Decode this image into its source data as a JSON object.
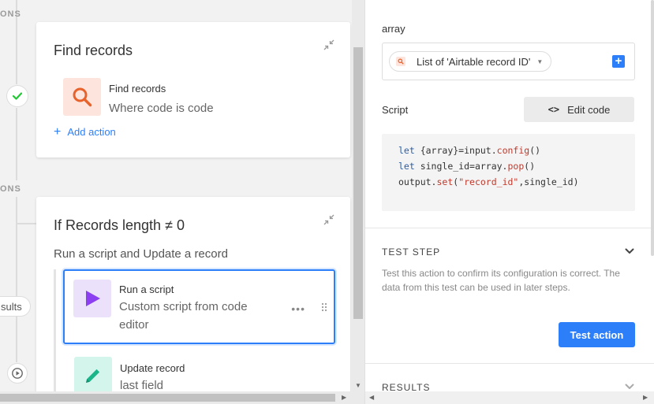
{
  "canvas": {
    "side_label_top": "ONS",
    "side_label_mid": "ONS",
    "results_pill": "sults",
    "find_card": {
      "title": "Find records",
      "step_name": "Find records",
      "step_desc": "Where code is code",
      "add_action": "Add action"
    },
    "if_card": {
      "title": "If Records length ≠ 0",
      "subtitle": "Run a script and Update a record",
      "steps": [
        {
          "name": "Run a script",
          "desc_line1": "Custom script from code",
          "desc_line2": "editor"
        },
        {
          "name": "Update record",
          "desc": "last field"
        }
      ]
    }
  },
  "panel": {
    "array_label": "array",
    "array_token": "List of 'Airtable record ID'",
    "script_label": "Script",
    "edit_code_label": "Edit code",
    "code": {
      "line1_kw": "let",
      "line1_rest_a": " {array}=input.",
      "line1_fn": "config",
      "line1_rest_b": "()",
      "line2_kw": "let",
      "line2_rest_a": " single_id=array.",
      "line2_fn": "pop",
      "line2_rest_b": "()",
      "line3_a": "output.",
      "line3_fn": "set",
      "line3_b": "(",
      "line3_str": "\"record_id\"",
      "line3_c": ",single_id)"
    },
    "test_step": {
      "title": "TEST STEP",
      "description": "Test this action to confirm its configuration is correct. The data from this test can be used in later steps.",
      "button": "Test action"
    },
    "results_title": "RESULTS"
  },
  "colors": {
    "accent": "#2d7ff9",
    "find_icon_bg": "#fde4dc",
    "find_icon": "#e8622c",
    "script_icon_bg": "#ece1fb",
    "script_icon": "#8b3ff0",
    "update_icon_bg": "#d4f5ec",
    "update_icon": "#1bb58a",
    "check": "#20c933"
  },
  "icons": [
    "search-icon",
    "play-icon",
    "pencil-icon",
    "check-icon",
    "collapse-icon",
    "code-icon",
    "chevron-down-icon",
    "plus-icon",
    "drag-handle-icon",
    "more-icon"
  ]
}
